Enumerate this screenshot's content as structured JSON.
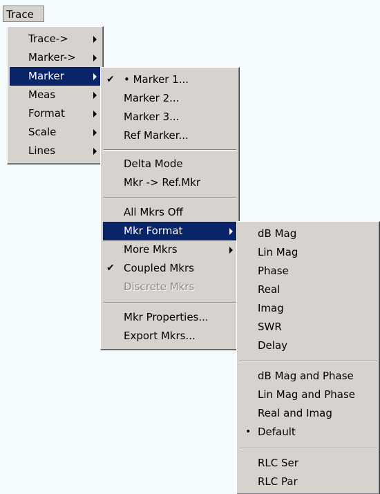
{
  "menubar": {
    "trace_label": "Trace"
  },
  "trace_menu": {
    "items": [
      {
        "label": "Trace->"
      },
      {
        "label": "Marker->"
      },
      {
        "label": "Marker"
      },
      {
        "label": "Meas"
      },
      {
        "label": "Format"
      },
      {
        "label": "Scale"
      },
      {
        "label": "Lines"
      }
    ]
  },
  "marker_menu": {
    "items": [
      {
        "label": "• Marker 1...",
        "checked": true
      },
      {
        "label": "Marker 2..."
      },
      {
        "label": "Marker 3..."
      },
      {
        "label": "Ref Marker..."
      },
      {
        "label": "Delta Mode"
      },
      {
        "label": "Mkr -> Ref.Mkr"
      },
      {
        "label": "All Mkrs Off"
      },
      {
        "label": "Mkr Format"
      },
      {
        "label": "More Mkrs"
      },
      {
        "label": "Coupled Mkrs",
        "checked": true
      },
      {
        "label": "Discrete Mkrs",
        "disabled": true
      },
      {
        "label": "Mkr Properties..."
      },
      {
        "label": "Export Mkrs..."
      }
    ]
  },
  "format_menu": {
    "items": [
      {
        "label": "dB Mag"
      },
      {
        "label": "Lin Mag"
      },
      {
        "label": "Phase"
      },
      {
        "label": "Real"
      },
      {
        "label": "Imag"
      },
      {
        "label": "SWR"
      },
      {
        "label": "Delay"
      },
      {
        "label": "dB Mag and Phase"
      },
      {
        "label": "Lin Mag and Phase"
      },
      {
        "label": "Real and Imag"
      },
      {
        "label": "Default",
        "bullet": "•"
      },
      {
        "label": "RLC Ser"
      },
      {
        "label": "RLC Par"
      }
    ]
  },
  "check_glyph": "✔",
  "colors": {
    "menu_bg": "#d6d3ce",
    "highlight": "#0a246a",
    "disabled": "#8a8a8a",
    "desktop": "#f3fbfd"
  }
}
